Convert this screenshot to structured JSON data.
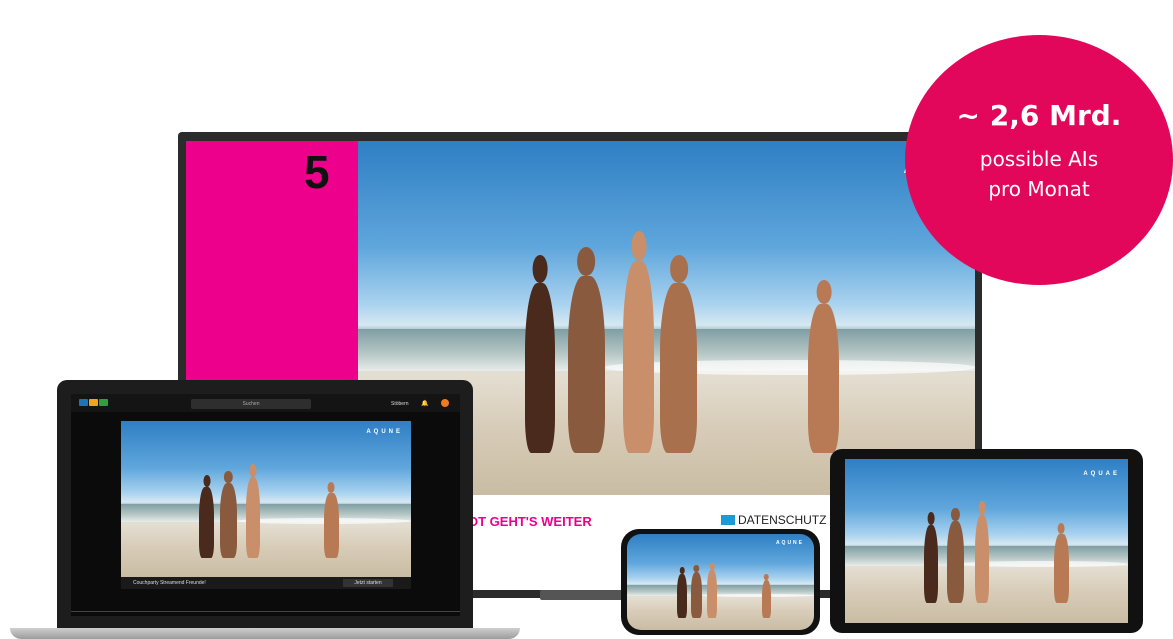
{
  "tv": {
    "channel_logo": "5",
    "watermark": "AQ",
    "ticker_text": "OT GEHT'S WEITER",
    "privacy_label": "DATENSCHUTZ"
  },
  "badge": {
    "headline": "~ 2,6 Mrd.",
    "line1": "possible AIs",
    "line2": "pro Monat"
  },
  "laptop": {
    "search_placeholder": "Suchen",
    "menu_label": "Stöbern",
    "watermark": "AQUNE",
    "show_title": "Couchparty Streamend Freunde!",
    "start_button": "Jetzt starten"
  },
  "tablet": {
    "watermark": "AQUAE"
  },
  "phone": {
    "watermark": "AQUNE"
  },
  "colors": {
    "brand_pink": "#ec008c",
    "badge": "#e2075a",
    "privacy_blue": "#1b9ad6"
  }
}
